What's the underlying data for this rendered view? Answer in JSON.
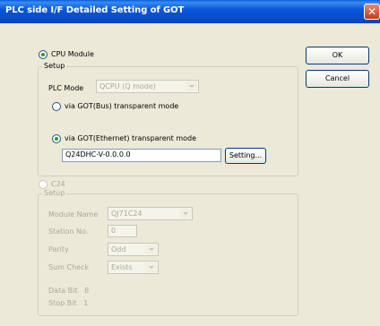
{
  "window": {
    "title": "PLC side I/F Detailed Setting of GOT",
    "close_glyph": "✕"
  },
  "cpu": {
    "radio_label": "CPU Module",
    "setup_legend": "Setup",
    "plc_mode_label": "PLC Mode",
    "plc_mode_value": "QCPU (Q mode)",
    "bus_label": "via GOT(Bus) transparent mode",
    "ethernet_label": "via GOT(Ethernet) transparent mode",
    "ethernet_value": "Q24DHC-V-0.0.0.0",
    "setting_button": "Setting..."
  },
  "c24": {
    "radio_label": "C24",
    "setup_legend": "Setup",
    "module_name_label": "Module Name",
    "module_name_value": "QJ71C24",
    "station_label": "Station No.",
    "station_value": "0",
    "parity_label": "Parity",
    "parity_value": "Odd",
    "sum_check_label": "Sum Check",
    "sum_check_value": "Exists",
    "data_bit": "Data Bit   8",
    "stop_bit": "Stop Bit   1"
  },
  "buttons": {
    "ok": "OK",
    "cancel": "Cancel"
  }
}
